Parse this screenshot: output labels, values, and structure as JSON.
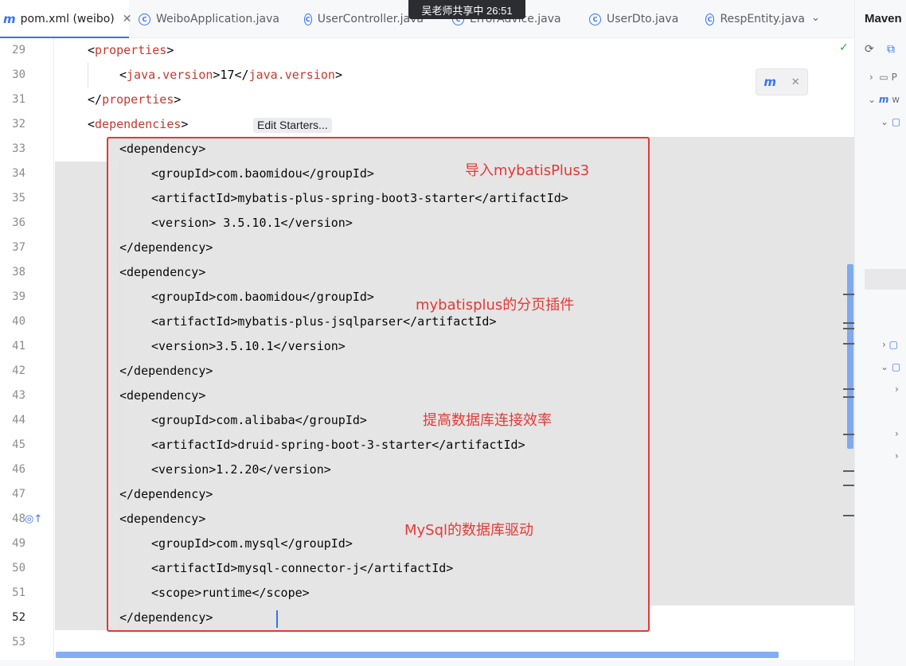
{
  "tabs": [
    {
      "label": "pom.xml (weibo)",
      "icon": "maven-icon",
      "active": true
    },
    {
      "label": "WeiboApplication.java",
      "icon": "class-icon",
      "active": false
    },
    {
      "label": "UserController.java",
      "icon": "class-icon",
      "active": false
    },
    {
      "label": "ErrorAdvice.java",
      "icon": "class-icon",
      "active": false
    },
    {
      "label": "UserDto.java",
      "icon": "class-icon",
      "active": false
    },
    {
      "label": "RespEntity.java",
      "icon": "class-icon",
      "active": false
    }
  ],
  "screen_share": "吴老师共享中 26:51",
  "maven_panel": {
    "title": "Maven",
    "tree": [
      {
        "label": "P",
        "depth": 0
      },
      {
        "label": "w",
        "depth": 0
      },
      {
        "label": "",
        "depth": 1
      },
      {
        "label": "",
        "depth": 1
      },
      {
        "label": "",
        "depth": 1
      }
    ]
  },
  "editor": {
    "edit_starters": "Edit Starters...",
    "current_line": "52",
    "lines": [
      {
        "n": "29",
        "indent": 1,
        "parts": [
          [
            "p",
            "<"
          ],
          [
            "t",
            "properties"
          ],
          [
            "p",
            ">"
          ]
        ]
      },
      {
        "n": "30",
        "indent": 2,
        "parts": [
          [
            "p",
            "<"
          ],
          [
            "t",
            "java.version"
          ],
          [
            "p",
            ">17</"
          ],
          [
            "t",
            "java.version"
          ],
          [
            "p",
            ">"
          ]
        ]
      },
      {
        "n": "31",
        "indent": 1,
        "parts": [
          [
            "p",
            "</"
          ],
          [
            "t",
            "properties"
          ],
          [
            "p",
            ">"
          ]
        ]
      },
      {
        "n": "32",
        "indent": 1,
        "parts": [
          [
            "p",
            "<"
          ],
          [
            "t",
            "dependencies"
          ],
          [
            "p",
            ">"
          ]
        ]
      },
      {
        "n": "33",
        "indent": 2,
        "parts": [
          [
            "p",
            "<dependency>"
          ]
        ]
      },
      {
        "n": "34",
        "indent": 3,
        "parts": [
          [
            "p",
            "<groupId>com.baomidou</groupId>"
          ]
        ]
      },
      {
        "n": "35",
        "indent": 3,
        "parts": [
          [
            "p",
            "<artifactId>mybatis-plus-spring-boot3-starter</artifactId>"
          ]
        ]
      },
      {
        "n": "36",
        "indent": 3,
        "parts": [
          [
            "p",
            "<version> 3.5.10.1</version>"
          ]
        ]
      },
      {
        "n": "37",
        "indent": 2,
        "parts": [
          [
            "p",
            "</dependency>"
          ]
        ]
      },
      {
        "n": "38",
        "indent": 2,
        "parts": [
          [
            "p",
            "<dependency>"
          ]
        ]
      },
      {
        "n": "39",
        "indent": 3,
        "parts": [
          [
            "p",
            "<groupId>com.baomidou</groupId>"
          ]
        ]
      },
      {
        "n": "40",
        "indent": 3,
        "parts": [
          [
            "p",
            "<artifactId>mybatis-plus-jsqlparser</artifactId>"
          ]
        ]
      },
      {
        "n": "41",
        "indent": 3,
        "parts": [
          [
            "p",
            "<version>3.5.10.1</version>"
          ]
        ]
      },
      {
        "n": "42",
        "indent": 2,
        "parts": [
          [
            "p",
            "</dependency>"
          ]
        ]
      },
      {
        "n": "43",
        "indent": 2,
        "parts": [
          [
            "p",
            "<dependency>"
          ]
        ]
      },
      {
        "n": "44",
        "indent": 3,
        "parts": [
          [
            "p",
            "<groupId>com.alibaba</groupId>"
          ]
        ]
      },
      {
        "n": "45",
        "indent": 3,
        "parts": [
          [
            "p",
            "<artifactId>druid-spring-boot-3-starter</artifactId>"
          ]
        ]
      },
      {
        "n": "46",
        "indent": 3,
        "parts": [
          [
            "p",
            "<version>1.2.20</version>"
          ]
        ]
      },
      {
        "n": "47",
        "indent": 2,
        "parts": [
          [
            "p",
            "</dependency>"
          ]
        ]
      },
      {
        "n": "48",
        "indent": 2,
        "parts": [
          [
            "p",
            "<dependency>"
          ]
        ]
      },
      {
        "n": "49",
        "indent": 3,
        "parts": [
          [
            "p",
            "<groupId>com.mysql</groupId>"
          ]
        ]
      },
      {
        "n": "50",
        "indent": 3,
        "parts": [
          [
            "p",
            "<artifactId>mysql-connector-j</artifactId>"
          ]
        ]
      },
      {
        "n": "51",
        "indent": 3,
        "parts": [
          [
            "p",
            "<scope>runtime</scope>"
          ]
        ]
      },
      {
        "n": "52",
        "indent": 2,
        "parts": [
          [
            "p",
            "</dependency>"
          ]
        ]
      },
      {
        "n": "53",
        "indent": 0,
        "parts": []
      }
    ]
  },
  "annotations": [
    {
      "id": "mybatisplus",
      "text": "导入mybatisPlus3"
    },
    {
      "id": "pagination",
      "text": "mybatisplus的分页插件"
    },
    {
      "id": "druid",
      "text": "提高数据库连接效率"
    },
    {
      "id": "mysql",
      "text": "MySql的数据库驱动"
    }
  ],
  "colors": {
    "accent": "#3574f0",
    "xml_tag": "#c7382f",
    "annotation_red": "#e53935",
    "selection_bg": "#e5e5e5"
  }
}
